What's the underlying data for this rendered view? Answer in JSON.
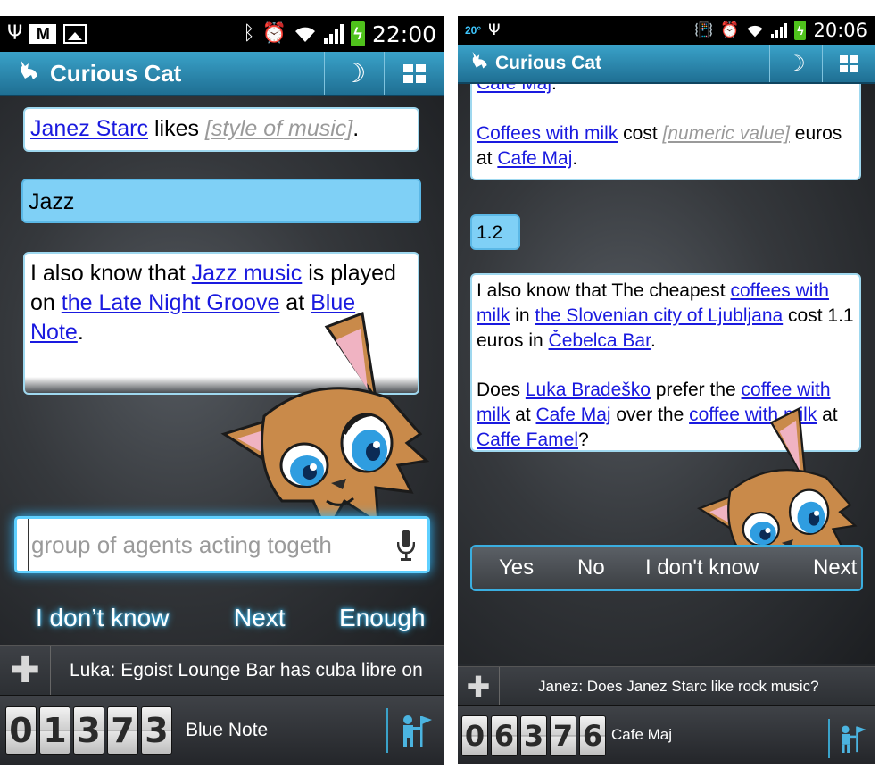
{
  "left_screen": {
    "status_bar": {
      "time": "22:00",
      "icons": [
        "usb-icon",
        "gmail-icon",
        "image-icon",
        "bluetooth-icon",
        "alarm-icon",
        "wifi-icon",
        "signal-icon",
        "battery-charging-icon"
      ]
    },
    "app_bar": {
      "title": "Curious Cat",
      "actions": [
        "night-mode-icon",
        "grid-menu-icon"
      ]
    },
    "messages": {
      "q1": {
        "link1": "Janez Starc",
        "text1": " likes ",
        "placeholder": "[style of music]",
        "text2": "."
      },
      "answer": "Jazz",
      "q2": {
        "t1": "I also know that ",
        "link1": "Jazz music",
        "t2": " is played on ",
        "link2": "the Late Night Groove",
        "t3": " at ",
        "link3": "Blue Note",
        "t4": "."
      }
    },
    "input": {
      "value": "group of agents acting togeth"
    },
    "answers": [
      "I don’t know",
      "Next",
      "Enough"
    ],
    "news": "Luka: Egoist Lounge Bar has cuba libre on",
    "score": [
      "0",
      "1",
      "3",
      "7",
      "3"
    ],
    "place": "Blue Note"
  },
  "right_screen": {
    "status_bar": {
      "temperature": "20°",
      "time": "20:06",
      "icons": [
        "usb-icon",
        "vibrate-icon",
        "alarm-icon",
        "wifi-icon",
        "signal-icon",
        "battery-charging-icon"
      ]
    },
    "app_bar": {
      "title": "Curious Cat",
      "actions": [
        "night-mode-icon",
        "grid-menu-icon"
      ]
    },
    "messages": {
      "q1_top": "Cafe Maj",
      "q1": {
        "link1": "Coffees with milk",
        "t1": " cost ",
        "placeholder": "[numeric value]",
        "t2": " euros at ",
        "link2": "Cafe Maj",
        "t3": "."
      },
      "answer": "1.2",
      "q2": {
        "t1": "I also know that The cheapest ",
        "link1": "coffees with milk",
        "t2": " in ",
        "link2": "the Slovenian city of Ljubljana",
        "t3": " cost 1.1 euros in ",
        "link3": "Čebelca Bar",
        "t4": "."
      },
      "q3": {
        "t1": "Does ",
        "link1": "Luka Bradeško",
        "t2": " prefer the ",
        "link2": "coffee with milk",
        "t3": " at ",
        "link3": "Cafe Maj",
        "t4": " over the ",
        "link4": "coffee with milk",
        "t5": " at ",
        "link5": "Caffe Famel",
        "t6": "?"
      }
    },
    "answers": [
      "Yes",
      "No",
      "I don't know",
      "Next"
    ],
    "news": "Janez: Does Janez Starc like rock music?",
    "score": [
      "0",
      "6",
      "3",
      "7",
      "6"
    ],
    "place": "Cafe Maj"
  },
  "colors": {
    "accent": "#3aa2c9",
    "link": "#1a1adf",
    "glow": "#3cc2ff",
    "user_bubble": "#7fd0f6"
  }
}
